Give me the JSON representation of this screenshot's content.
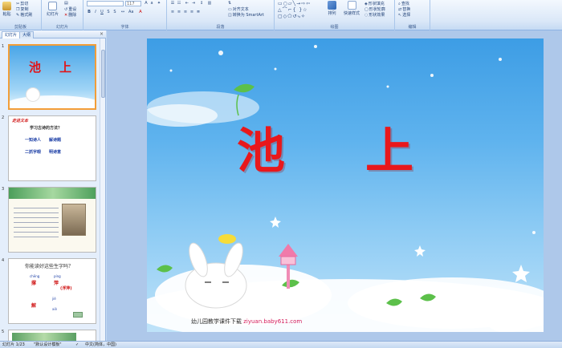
{
  "ribbon": {
    "clipboard": {
      "paste": "粘贴",
      "cut": "剪切",
      "copy": "复制",
      "format_painter": "格式刷",
      "group_label": "剪贴板"
    },
    "slides": {
      "new_slide": "新建幻灯片",
      "new_slide_short": "幻灯片",
      "reset": "重设",
      "delete": "删除",
      "group_label": "幻灯片"
    },
    "font": {
      "font_size": "117",
      "group_label": "字体"
    },
    "paragraph": {
      "align_text": "对齐文本",
      "convert_smartart": "转换为 SmartArt",
      "group_label": "段落"
    },
    "drawing": {
      "arrange": "排列",
      "quick_styles": "快速样式",
      "shape_fill": "形状填充",
      "shape_outline": "形状轮廓",
      "shape_effects": "形状效果",
      "group_label": "绘图"
    },
    "editing": {
      "find": "查找",
      "replace": "替换",
      "select": "选择",
      "group_label": "编辑"
    }
  },
  "panel": {
    "tab_slides": "幻灯片",
    "tab_outline": "大纲",
    "close": "×"
  },
  "thumbnails": [
    {
      "num": "1",
      "title_left": "池",
      "title_right": "上"
    },
    {
      "num": "2",
      "header": "走进文本",
      "line1": "学习古诗的方法？",
      "line2a": "一知诗人",
      "line2b": "解诗题",
      "line3a": "二抓字眼",
      "line3b": "明诗意"
    },
    {
      "num": "3"
    },
    {
      "num": "4",
      "question": "你能读好这些生字吗？",
      "p1_pinyin": "chēng",
      "p1_char": "撑",
      "p2_pinyin": "píng",
      "p2_char": "萍",
      "p2_extra": "(浮萍)",
      "p3_char": "解",
      "p3_pinyin_a": "jiě",
      "p3_pinyin_b": "xiè"
    },
    {
      "num": "5"
    }
  ],
  "slide": {
    "title_left": "池",
    "title_right": "上",
    "footer_text": "幼儿园教学课件下载",
    "footer_url": "ziyuan.baby611.com"
  },
  "status": {
    "slide_count": "幻灯片 1/23",
    "theme": "\"默认设计模板\"",
    "language": "中文(简体，中国)"
  }
}
